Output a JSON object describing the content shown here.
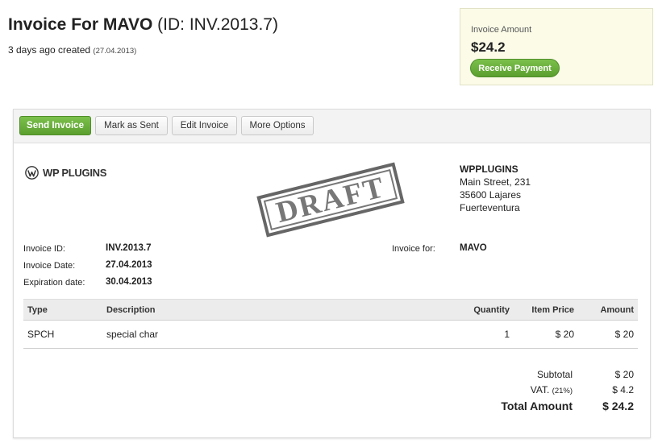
{
  "header": {
    "title_prefix": "Invoice For",
    "client": "MAVO",
    "id_text": "(ID: INV.2013.7)",
    "created_text": "3 days ago created",
    "created_date": "(27.04.2013)"
  },
  "amount_box": {
    "label": "Invoice Amount",
    "value": "$24.2",
    "receive_button": "Receive Payment"
  },
  "toolbar": {
    "send": "Send Invoice",
    "mark_sent": "Mark as Sent",
    "edit": "Edit Invoice",
    "more": "More Options"
  },
  "logo": {
    "text": "WP PLUGINS",
    "icon": "wordpress-icon"
  },
  "stamp": {
    "text": "DRAFT"
  },
  "company": {
    "name": "WPPLUGINS",
    "street": "Main Street, 231",
    "city": "35600 Lajares",
    "region": "Fuerteventura"
  },
  "meta": {
    "invoice_id_label": "Invoice ID:",
    "invoice_id": "INV.2013.7",
    "invoice_date_label": "Invoice Date:",
    "invoice_date": "27.04.2013",
    "expiration_label": "Expiration date:",
    "expiration_date": "30.04.2013",
    "invoice_for_label": "Invoice for:",
    "invoice_for": "MAVO"
  },
  "table": {
    "headers": [
      "Type",
      "Description",
      "Quantity",
      "Item Price",
      "Amount"
    ],
    "rows": [
      {
        "type": "SPCH",
        "description": "special char",
        "quantity": "1",
        "item_price": "$ 20",
        "amount": "$ 20"
      }
    ]
  },
  "totals": {
    "subtotal_label": "Subtotal",
    "subtotal": "$ 20",
    "vat_label": "VAT.",
    "vat_rate": "(21%)",
    "vat": "$ 4.2",
    "total_label": "Total Amount",
    "total": "$ 24.2"
  },
  "colors": {
    "accent_green": "#5b9f2f",
    "amount_box_bg": "#fbfbe8"
  }
}
